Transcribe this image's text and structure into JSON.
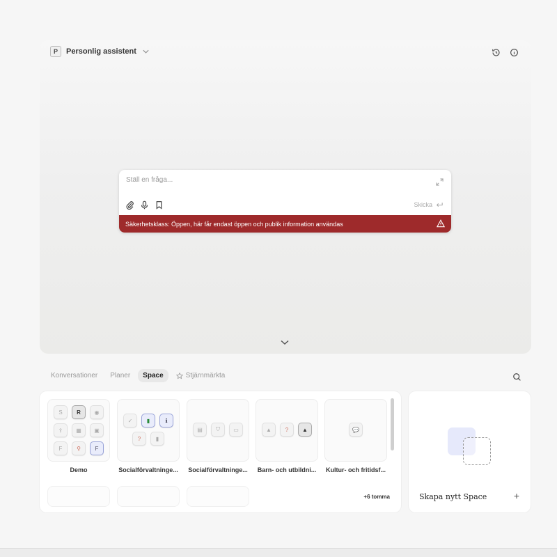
{
  "assistant": {
    "avatar_letter": "P",
    "name": "Personlig assistent"
  },
  "header_icons": [
    "history-icon",
    "info-icon"
  ],
  "chat": {
    "placeholder": "Ställ en fråga...",
    "value": "",
    "send_label": "Skicka",
    "tool_icons": [
      "paperclip-icon",
      "microphone-icon",
      "bookmark-icon"
    ],
    "security_text": "Säkerhetsklass: Öppen, här får endast öppen och publik information användas"
  },
  "colors": {
    "security_banner": "#9e2a2b",
    "accent_tint": "#e6e9fb"
  },
  "tabs": [
    {
      "label": "Konversationer",
      "active": false
    },
    {
      "label": "Planer",
      "active": false
    },
    {
      "label": "Space",
      "active": true
    },
    {
      "label": "Stjärnmärkta",
      "active": false,
      "icon": "star-icon"
    }
  ],
  "spaces": [
    {
      "name": "Demo",
      "badges": [
        "S",
        "R",
        "",
        "",
        "",
        "",
        "F",
        "",
        "F"
      ]
    },
    {
      "name": "Socialförvaltninge...",
      "badges": [
        "",
        "",
        "",
        "?",
        ""
      ]
    },
    {
      "name": "Socialförvaltninge...",
      "badges": [
        "",
        "",
        ""
      ]
    },
    {
      "name": "Barn- och utbildni...",
      "badges": [
        "",
        "?",
        ""
      ]
    },
    {
      "name": "Kultur- och fritidsf...",
      "badges": [
        ""
      ]
    }
  ],
  "empty_count_label": "+6 tomma",
  "new_space": {
    "label": "Skapa nytt Space",
    "plus": "+"
  }
}
